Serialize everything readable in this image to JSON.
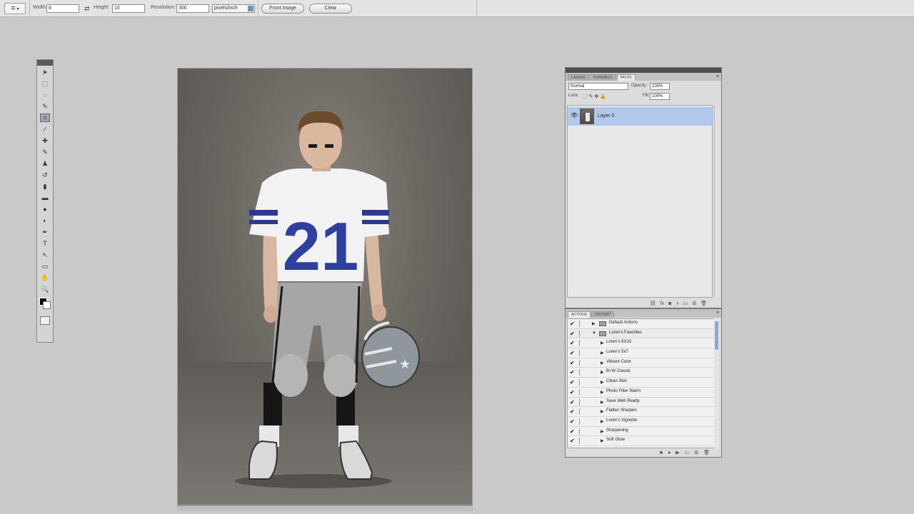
{
  "options_bar": {
    "width_label": "Width:",
    "width_value": "8",
    "height_label": "Height:",
    "height_value": "10",
    "resolution_label": "Resolution:",
    "resolution_value": "300",
    "resolution_unit": "pixels/inch",
    "front_image_label": "Front Image",
    "clear_label": "Clear"
  },
  "tools": [
    {
      "icon": "move-icon",
      "glyph": "➤"
    },
    {
      "icon": "marquee-icon",
      "glyph": "⬚"
    },
    {
      "icon": "lasso-icon",
      "glyph": "◌"
    },
    {
      "icon": "quick-selection-icon",
      "glyph": "✎"
    },
    {
      "icon": "crop-icon",
      "glyph": "⌗",
      "active": true
    },
    {
      "icon": "eyedropper-icon",
      "glyph": "⁄"
    },
    {
      "icon": "healing-brush-icon",
      "glyph": "✚"
    },
    {
      "icon": "brush-icon",
      "glyph": "✎"
    },
    {
      "icon": "clone-stamp-icon",
      "glyph": "♟"
    },
    {
      "icon": "history-brush-icon",
      "glyph": "↺"
    },
    {
      "icon": "eraser-icon",
      "glyph": "▮"
    },
    {
      "icon": "gradient-icon",
      "glyph": "▬"
    },
    {
      "icon": "blur-icon",
      "glyph": "●"
    },
    {
      "icon": "dodge-icon",
      "glyph": "◐"
    },
    {
      "icon": "pen-icon",
      "glyph": "✒"
    },
    {
      "icon": "type-icon",
      "glyph": "T"
    },
    {
      "icon": "path-selection-icon",
      "glyph": "↖"
    },
    {
      "icon": "shape-icon",
      "glyph": "▭"
    },
    {
      "icon": "hand-icon",
      "glyph": "✋"
    },
    {
      "icon": "zoom-icon",
      "glyph": "🔍"
    }
  ],
  "layers_panel": {
    "tabs": [
      "LAYERS",
      "CHANNELS",
      "PATHS"
    ],
    "blend_mode": "Normal",
    "opacity_label": "Opacity:",
    "opacity_value": "100%",
    "lock_label": "Lock:",
    "fill_label": "Fill:",
    "fill_value": "100%",
    "layer_name": "Layer 0"
  },
  "actions_panel": {
    "tabs": [
      "ACTIONS",
      "HISTORY"
    ],
    "sets": [
      {
        "label": "Default Actions",
        "open": false
      },
      {
        "label": "Loren's Favorites",
        "open": true
      }
    ],
    "items": [
      "Loren's 8X10",
      "Loren's 5x7",
      "Vibrant Color",
      "B+W Classic",
      "Clean Skin",
      "Photo Filter Warm",
      "Save Web Ready",
      "Flatten Sharpen",
      "Loren's Vignette",
      "Sharpening",
      "Soft Glow"
    ]
  }
}
